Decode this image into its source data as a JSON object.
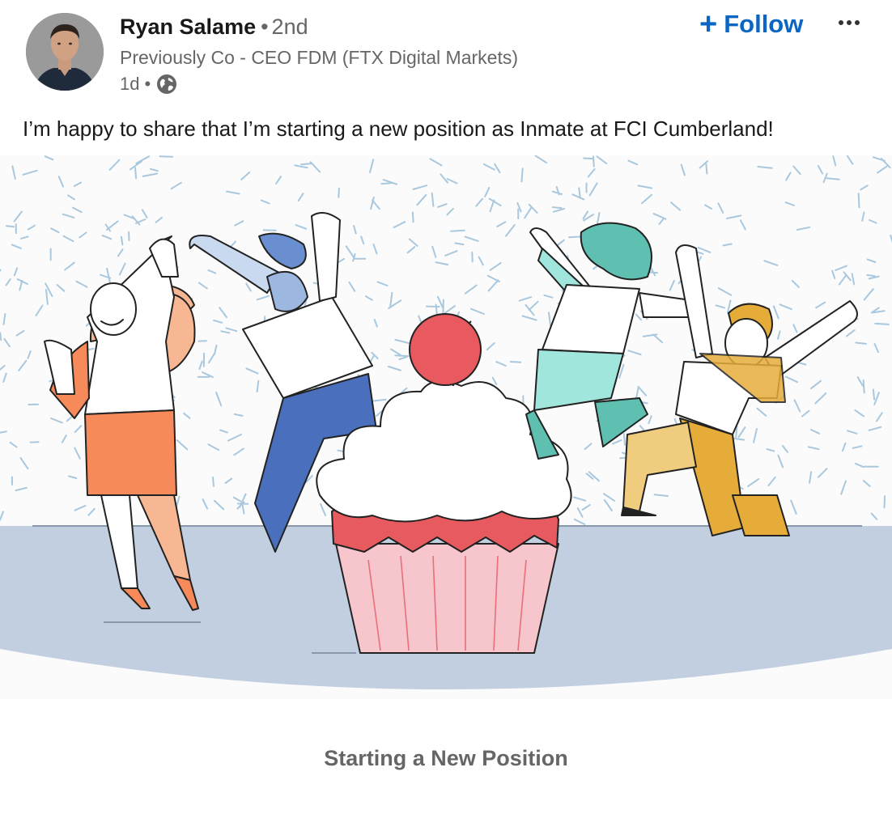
{
  "author": {
    "name": "Ryan Salame",
    "degree_separator": "•",
    "degree": "2nd",
    "headline": "Previously Co - CEO FDM (FTX Digital Markets)",
    "time_ago": "1d",
    "time_separator": "•",
    "visibility_icon": "globe-icon"
  },
  "actions": {
    "follow_label": "Follow",
    "follow_icon": "plus-icon",
    "more_icon": "ellipsis-icon"
  },
  "post": {
    "text": "I’m happy to share that I’m starting a new position as Inmate at FCI Cumberland!",
    "caption": "Starting a New Position"
  },
  "colors": {
    "accent": "#0a66c2",
    "floor": "#c2cfe0",
    "cherry": "#e85a60",
    "frosting_base": "#e65a60",
    "wrapper": "#f6c6cc"
  }
}
